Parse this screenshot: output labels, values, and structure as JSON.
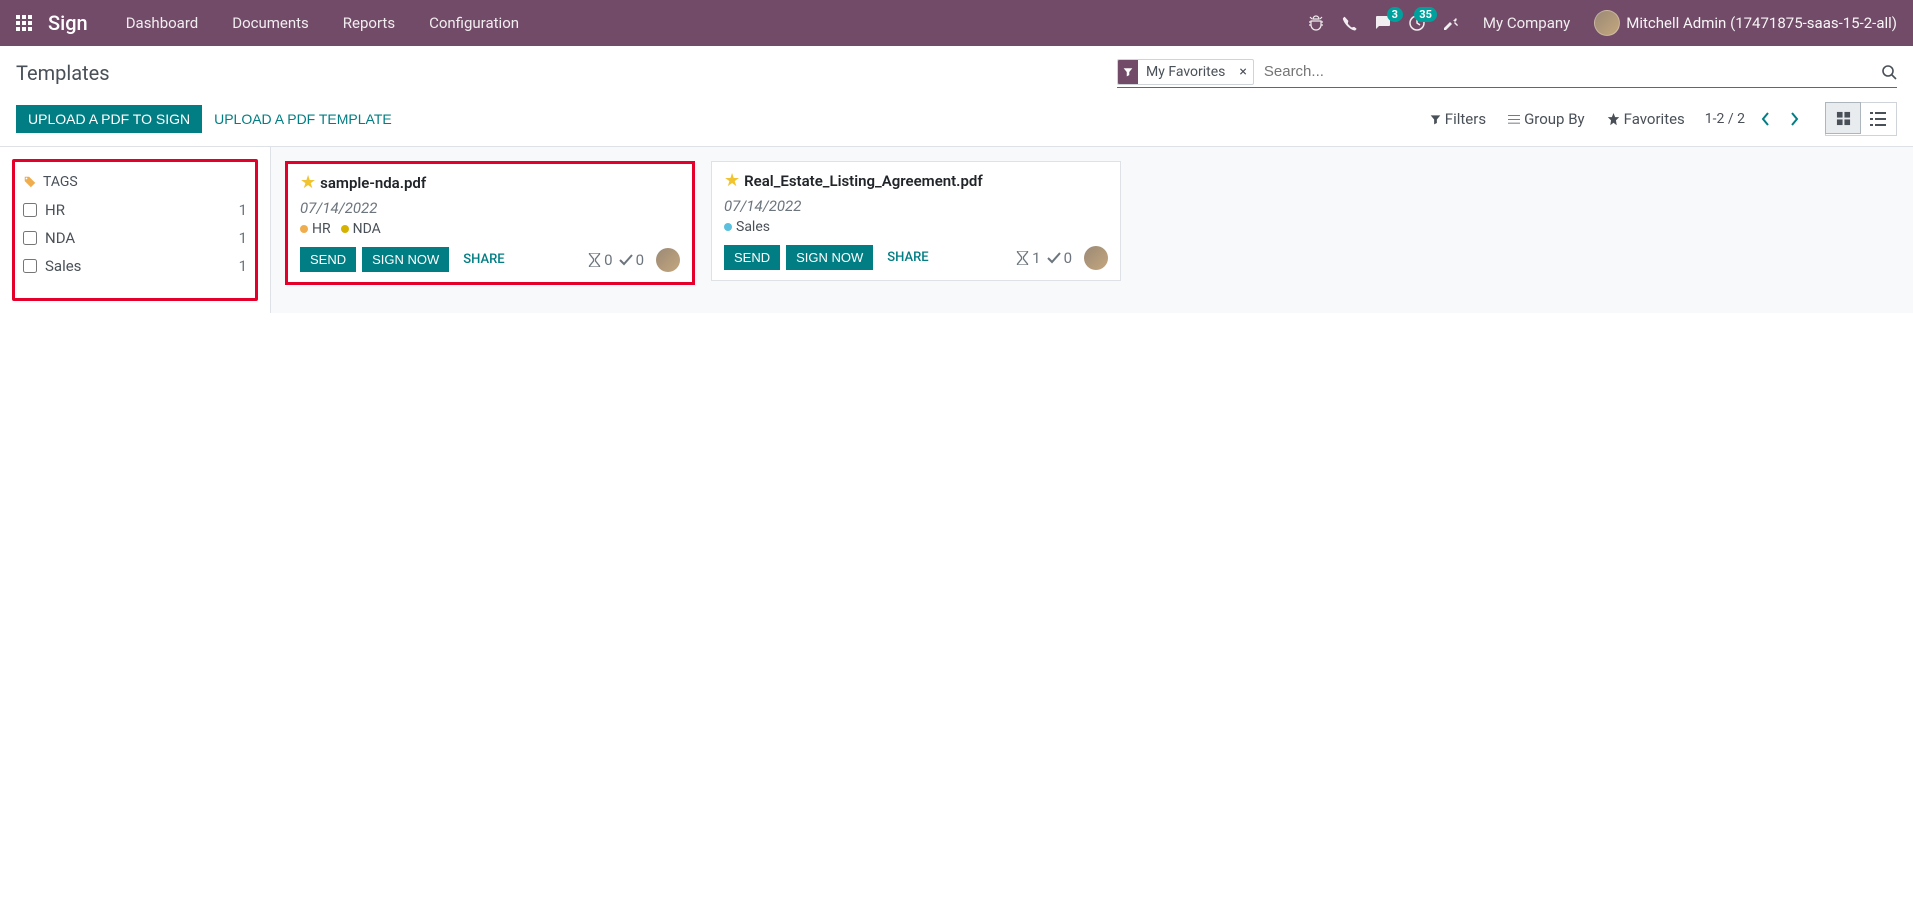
{
  "navbar": {
    "brand": "Sign",
    "menu": [
      "Dashboard",
      "Documents",
      "Reports",
      "Configuration"
    ],
    "messages_badge": "3",
    "activities_badge": "35",
    "company": "My Company",
    "user": "Mitchell Admin (17471875-saas-15-2-all)"
  },
  "control_panel": {
    "title": "Templates",
    "search_facet": "My Favorites",
    "search_placeholder": "Search...",
    "btn_upload_sign": "Upload a PDF to Sign",
    "btn_upload_template": "Upload a PDF Template",
    "filters": "Filters",
    "group_by": "Group By",
    "favorites": "Favorites",
    "pager": "1-2 / 2"
  },
  "sidebar": {
    "header": "TAGS",
    "tags": [
      {
        "label": "HR",
        "count": "1"
      },
      {
        "label": "NDA",
        "count": "1"
      },
      {
        "label": "Sales",
        "count": "1"
      }
    ]
  },
  "cards": [
    {
      "title": "sample-nda.pdf",
      "date": "07/14/2022",
      "tags": [
        {
          "label": "HR",
          "color": "dot-orange"
        },
        {
          "label": "NDA",
          "color": "dot-yellow"
        }
      ],
      "send": "SEND",
      "sign_now": "SIGN NOW",
      "share": "SHARE",
      "pending": "0",
      "signed": "0",
      "highlighted": true
    },
    {
      "title": "Real_Estate_Listing_Agreement.pdf",
      "date": "07/14/2022",
      "tags": [
        {
          "label": "Sales",
          "color": "dot-blue"
        }
      ],
      "send": "SEND",
      "sign_now": "SIGN NOW",
      "share": "SHARE",
      "pending": "1",
      "signed": "0",
      "highlighted": false
    }
  ]
}
